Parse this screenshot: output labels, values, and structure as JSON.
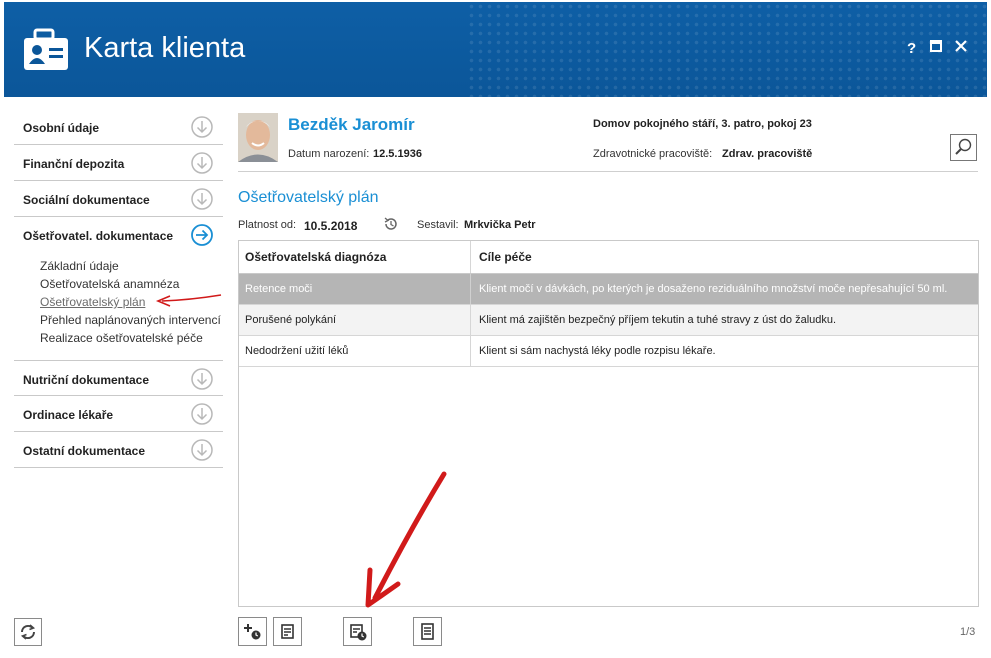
{
  "header": {
    "title": "Karta klienta",
    "help_label": "?",
    "maximize_label": "▣",
    "close_label": "✕"
  },
  "sidebar": {
    "items": [
      {
        "label": "Osobní údaje"
      },
      {
        "label": "Finanční depozita"
      },
      {
        "label": "Sociální dokumentace"
      },
      {
        "label": "Ošetřovatel. dokumentace"
      },
      {
        "label": "Nutriční dokumentace"
      },
      {
        "label": "Ordinace lékaře"
      },
      {
        "label": "Ostatní dokumentace"
      }
    ],
    "subitems": [
      {
        "label": "Základní údaje"
      },
      {
        "label": "Ošetřovatelská anamnéza"
      },
      {
        "label": "Ošetřovatelský plán"
      },
      {
        "label": "Přehled naplánovaných intervencí"
      },
      {
        "label": "Realizace ošetřovatelské péče"
      }
    ]
  },
  "client": {
    "name": "Bezděk Jaromír",
    "dob_label": "Datum narození:",
    "dob_value": "12.5.1936",
    "location": "Domov pokojného stáří, 3. patro, pokoj 23",
    "workplace_label": "Zdravotnické pracoviště:",
    "workplace_value": "Zdrav. pracoviště"
  },
  "plan": {
    "title": "Ošetřovatelský plán",
    "valid_from_label": "Platnost od:",
    "valid_from_value": "10.5.2018",
    "author_label": "Sestavil:",
    "author_value": "Mrkvička Petr"
  },
  "table": {
    "headers": [
      "Ošetřovatelská diagnóza",
      "Cíle péče"
    ],
    "rows": [
      [
        "Retence moči",
        "Klient močí v dávkách, po kterých je dosaženo reziduálního množství moče nepřesahující 50 ml."
      ],
      [
        "Porušené polykání",
        "Klient má zajištěn bezpečný příjem tekutin a tuhé stravy z úst do žaludku."
      ],
      [
        "Nedodržení užití léků",
        "Klient si sám nachystá léky podle rozpisu lékaře."
      ]
    ]
  },
  "footer": {
    "pager": "1/3"
  },
  "colors": {
    "header_bg": "#0b5699",
    "accent": "#1a8fd4",
    "selected_row": "#b5b5b5",
    "annotation_arrow": "#d11a1a"
  },
  "icons": [
    "id-card-icon",
    "chevron-down-circle-icon",
    "arrow-right-circle-icon",
    "search-icon",
    "history-icon",
    "add-schedule-icon",
    "edit-document-icon",
    "calendar-clock-icon",
    "document-list-icon",
    "refresh-icon"
  ]
}
